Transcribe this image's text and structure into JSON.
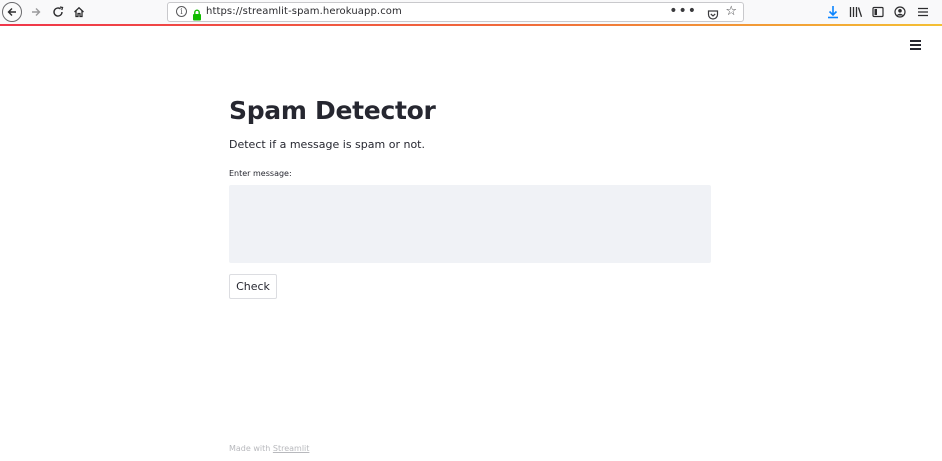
{
  "browser": {
    "url": "https://streamlit-spam.herokuapp.com",
    "url_info_glyph": "i",
    "more_glyph": "•••",
    "bookmark_glyph": "☆",
    "icons": {
      "back": "back-arrow-icon",
      "forward": "forward-arrow-icon",
      "reload": "reload-icon",
      "home": "home-icon",
      "lock": "lock-icon",
      "pocket": "pocket-icon",
      "bookmark": "star-icon",
      "downloads": "download-icon",
      "library": "library-icon",
      "sidebar": "sidebar-icon",
      "account": "account-icon",
      "menu": "hamburger-menu-icon"
    },
    "colors": {
      "lock": "#12bc00",
      "download": "#0a84ff",
      "progress_start": "#f0364a",
      "progress_end": "#f4c034"
    }
  },
  "app": {
    "title": "Spam Detector",
    "subtitle": "Detect if a message is spam or not.",
    "input_label": "Enter message:",
    "message_value": "",
    "button_label": "Check",
    "footer_prefix": "Made with ",
    "footer_link": "Streamlit",
    "colors": {
      "text": "#262730",
      "input_bg": "#f0f2f6",
      "footer": "#b8b9bd"
    }
  }
}
